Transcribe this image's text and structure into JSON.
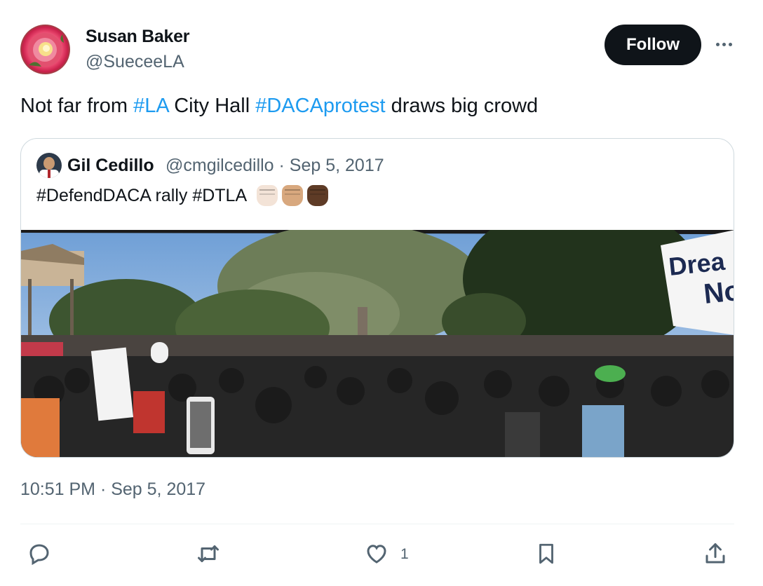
{
  "author": {
    "name": "Susan Baker",
    "handle": "@SueceeLA"
  },
  "follow_label": "Follow",
  "tweet": {
    "text_parts": [
      {
        "text": "Not far from ",
        "hashtag": false
      },
      {
        "text": "#LA",
        "hashtag": true
      },
      {
        "text": " City Hall ",
        "hashtag": false
      },
      {
        "text": "#DACAprotest",
        "hashtag": true
      },
      {
        "text": " draws big crowd",
        "hashtag": false
      }
    ]
  },
  "quoted": {
    "name": "Gil Cedillo",
    "meta": "@cmgilcedillo · Sep 5, 2017",
    "text": "#DefendDACA rally #DTLA",
    "emojis": [
      "raised-fist-light",
      "raised-fist-medium",
      "raised-fist-dark"
    ],
    "photo_sign": [
      "Drea",
      "No"
    ]
  },
  "timestamp": "10:51 PM · Sep 5, 2017",
  "actions": {
    "reply_icon": "reply-icon",
    "retweet_icon": "retweet-icon",
    "like_icon": "heart-icon",
    "like_count": "1",
    "bookmark_icon": "bookmark-icon",
    "share_icon": "share-icon"
  },
  "colors": {
    "hashtag": "#1d9bf0",
    "follow_bg": "#0f1419",
    "muted_text": "#536471",
    "border": "#cfd9de",
    "fist_light": "#f3e3d7",
    "fist_medium": "#d8a87e",
    "fist_dark": "#5e3b26"
  }
}
